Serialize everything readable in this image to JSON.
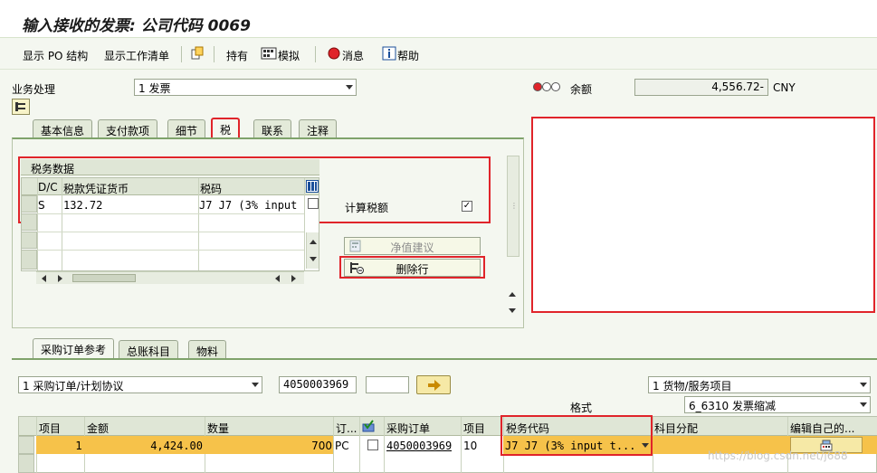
{
  "window": {
    "title": "输入接收的发票: 公司代码 0069"
  },
  "toolbar": {
    "show_po_structure": "显示 PO 结构",
    "show_worklist": "显示工作清单",
    "hold": "持有",
    "simulate": "模拟",
    "messages": "消息",
    "help": "帮助"
  },
  "header": {
    "transaction_label": "业务处理",
    "transaction_value": "1 发票",
    "balance_label": "余额",
    "balance_value": "4,556.72-",
    "currency": "CNY"
  },
  "tabs": [
    {
      "label": "基本信息"
    },
    {
      "label": "支付款项"
    },
    {
      "label": "细节"
    },
    {
      "label": "税"
    },
    {
      "label": "联系"
    },
    {
      "label": "注释"
    }
  ],
  "tax_panel": {
    "group_title": "税务数据",
    "columns": [
      "D/C",
      "税款凭证货币",
      "税码"
    ],
    "rows": [
      {
        "dc": "S",
        "amount": "132.72",
        "tax_code": "J7 J7 (3% input"
      }
    ],
    "calc_tax_label": "计算税额",
    "calc_tax_checked": "✓",
    "net_suggest_button": "净值建议",
    "delete_row_button": "删除行"
  },
  "bottom_tabs": [
    {
      "label": "采购订单参考"
    },
    {
      "label": "总账科目"
    },
    {
      "label": "物料"
    }
  ],
  "po_reference": {
    "ref_type": "1 采购订单/计划协议",
    "po_number": "4050003969",
    "item_type": "1 货物/服务项目",
    "layout_label": "格式",
    "layout_value": "6_6310 发票缩减"
  },
  "items_table": {
    "columns": [
      "项目",
      "金额",
      "数量",
      "订...",
      "",
      "采购订单",
      "项目",
      "税务代码",
      "科目分配",
      "编辑自己的..."
    ],
    "rows": [
      {
        "item": "1",
        "amount": "4,424.00",
        "quantity": "700",
        "unit": "PC",
        "po": "4050003969",
        "po_item": "10",
        "tax_code": "J7 J7 (3% input t..."
      }
    ]
  },
  "watermark": "https://blog.csdn.net/j688",
  "colors": {
    "accent_red": "#e0242a",
    "row_highlight": "#f6c24a",
    "panel_bg": "#f4f7f0"
  }
}
